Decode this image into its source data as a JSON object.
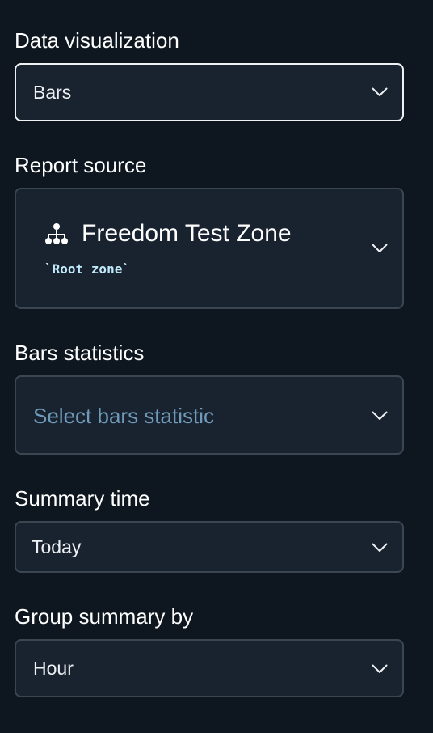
{
  "fields": {
    "data_visualization": {
      "label": "Data visualization",
      "value": "Bars"
    },
    "report_source": {
      "label": "Report source",
      "zone_name": "Freedom Test Zone",
      "zone_subtitle": "`Root zone`",
      "icon": "hierarchy-icon"
    },
    "bars_statistics": {
      "label": "Bars statistics",
      "placeholder": "Select bars statistic"
    },
    "summary_time": {
      "label": "Summary time",
      "value": "Today"
    },
    "group_summary_by": {
      "label": "Group summary by",
      "value": "Hour"
    }
  },
  "colors": {
    "background": "#0e1720",
    "field_background": "#19232f",
    "field_border": "#3b4653",
    "focused_border": "#eef1f4",
    "placeholder": "#6f9ab9",
    "subtitle": "#bfe8fb"
  }
}
